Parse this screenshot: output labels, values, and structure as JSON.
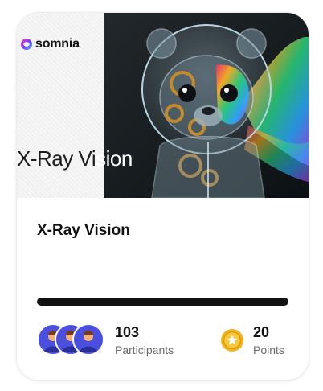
{
  "brand": {
    "name": "somnia",
    "logo_icon": "somnia-logo-icon"
  },
  "quest": {
    "banner_title_left": "X-Ray Vi",
    "banner_title_right": "sion",
    "title": "X-Ray Vision",
    "progress": 1.0
  },
  "stats": {
    "participants_value": "103",
    "participants_label": "Participants",
    "points_value": "20",
    "points_label": "Points",
    "points_icon": "star-coin-icon"
  },
  "colors": {
    "accent_dark": "#111111",
    "avatar_blue": "#4b4fe0",
    "coin_gold": "#f2b418"
  }
}
